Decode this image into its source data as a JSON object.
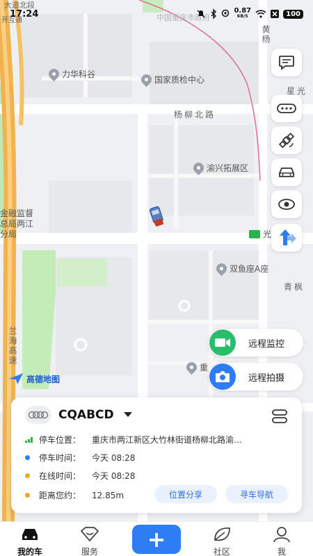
{
  "status_bar": {
    "time": "17:24",
    "net_speed": "0.87",
    "net_unit": "KB/S",
    "battery": "100"
  },
  "map": {
    "pois": [
      {
        "name": "力华科谷"
      },
      {
        "name": "国家质检中心"
      },
      {
        "name": "渝兴拓展区"
      },
      {
        "name": "双鱼座A座"
      },
      {
        "name": "重"
      }
    ],
    "roads": {
      "yangliu_north": "杨柳北路",
      "huang_yang": "黄杨",
      "xing_guang": "星光",
      "qing_feng": "青枫",
      "lanhai": "兰海高速",
      "guang": "光",
      "top_left": "大道北段",
      "top_left2": "开互通"
    },
    "district_label": "金融监督\n总局两江\n分局",
    "top_faded_label": "中国重庆市政府",
    "logo_text": "高德地图"
  },
  "side_buttons": [
    {
      "icon": "message-icon"
    },
    {
      "icon": "license-plate-icon"
    },
    {
      "icon": "satellite-icon"
    },
    {
      "icon": "car-icon"
    },
    {
      "icon": "eye-icon"
    },
    {
      "icon": "navigation-arrow-icon"
    }
  ],
  "remote": {
    "monitor_label": "远程监控",
    "photo_label": "远程拍摄",
    "monitor_color": "#2bbd6e",
    "photo_color": "#2f7df6"
  },
  "card": {
    "plate": "CQABCD",
    "rows": [
      {
        "label": "停车位置：",
        "value": "重庆市两江新区大竹林街道杨柳北路渝…",
        "color": "#2bb14e"
      },
      {
        "label": "停车时间：",
        "value": "今天 08:28",
        "color": "#2f7df6"
      },
      {
        "label": "在线时间：",
        "value": "今天 08:28",
        "color": "#f5a623"
      },
      {
        "label": "距离您约：",
        "value": "12.85m",
        "color": "#f5a623"
      }
    ],
    "share_label": "位置分享",
    "navigate_label": "寻车导航"
  },
  "nav": {
    "my_car": "我的车",
    "service": "服务",
    "add": "+",
    "community": "社区",
    "me": "我"
  }
}
